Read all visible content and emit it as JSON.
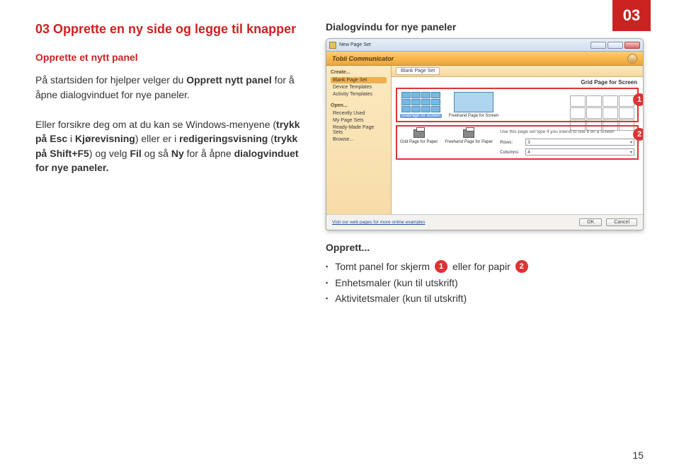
{
  "topBadge": "03",
  "left": {
    "heading": "03 Opprette en ny side og legge til knapper",
    "subhead": "Opprette et nytt panel",
    "para1_pre": "På startsiden for hjelper velger du ",
    "para1_bold": "Opprett nytt panel",
    "para1_post": " for å åpne dialogvinduet for nye paneler.",
    "para2_pre": "Eller forsikre deg om at du kan se Windows-menyene (",
    "para2_b1": "trykk på Esc",
    "para2_mid1": " i ",
    "para2_b2": "Kjørevisning",
    "para2_mid2": ") eller er i ",
    "para2_b3": "redigeringsvisning",
    "para2_mid3": " (",
    "para2_b4": "trykk på Shift+F5",
    "para2_mid4": ") og velg ",
    "para2_b5": "Fil",
    "para2_mid5": " og så ",
    "para2_b6": "Ny",
    "para2_mid6": " for å åpne ",
    "para2_b7": "dialogvinduet for nye paneler.",
    "para2_post": ""
  },
  "right": {
    "dialogTitle": "Dialogvindu for nye paneler",
    "dlg": {
      "winTitle": "New Page Set",
      "brand": "Tobii Communicator",
      "side": {
        "sec1": "Create...",
        "items1": [
          "Blank Page Set",
          "Device Templates",
          "Activity Templates"
        ],
        "sec2": "Open...",
        "items2": [
          "Recently Used",
          "My Page Sets",
          "Ready-Made Page Sets",
          "Browse..."
        ]
      },
      "tab1": "Blank Page Set",
      "mainTitle": "Grid Page for Screen",
      "gp1": "GridPage for Screen",
      "gp2": "Freehand Page for Screen",
      "gp3": "Grid Page for Paper",
      "gp4": "Freehand Page for Paper",
      "hint": "Use this page set type if you intend to use it on a screen",
      "rowsLabel": "Rows:",
      "rowsVal": "3",
      "colsLabel": "Columns:",
      "colsVal": "4",
      "footerLink": "Visit our web pages for more online examples",
      "ok": "OK",
      "cancel": "Cancel",
      "badge1": "1",
      "badge2": "2"
    },
    "opprett": {
      "title": "Opprett...",
      "li1_pre": "Tomt panel for skjerm ",
      "li1_b1": "1",
      "li1_mid": " eller for papir ",
      "li1_b2": "2",
      "li2": "Enhetsmaler (kun til utskrift)",
      "li3": "Aktivitetsmaler (kun til utskrift)"
    }
  },
  "pageNum": "15"
}
